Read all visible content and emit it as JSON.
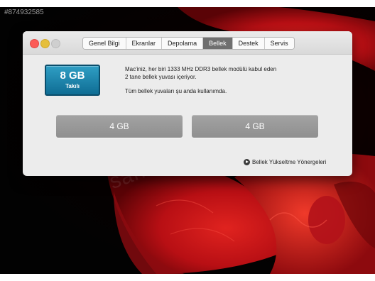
{
  "stock_id": "#874932585",
  "watermark": "sahibinden.c",
  "colors": {
    "desktop": "#050505",
    "fish": "#c8141a",
    "memory_icon": "#1c87b0",
    "slot": "#999999",
    "tab_active": "#6f6f6f"
  },
  "window": {
    "tabs": [
      {
        "label": "Genel Bilgi",
        "active": false
      },
      {
        "label": "Ekranlar",
        "active": false
      },
      {
        "label": "Depolama",
        "active": false
      },
      {
        "label": "Bellek",
        "active": true
      },
      {
        "label": "Destek",
        "active": false
      },
      {
        "label": "Servis",
        "active": false
      }
    ],
    "memory": {
      "size": "8 GB",
      "state": "Takılı"
    },
    "info": {
      "line1": "Mac'iniz, her biri 1333 MHz DDR3 bellek modülü kabul eden",
      "line2": "2 tane bellek yuvası içeriyor.",
      "line3": "Tüm bellek yuvaları şu anda kullanımda."
    },
    "slots": [
      "4 GB",
      "4 GB"
    ],
    "upgrade_link": "Bellek Yükseltme Yönergeleri"
  }
}
